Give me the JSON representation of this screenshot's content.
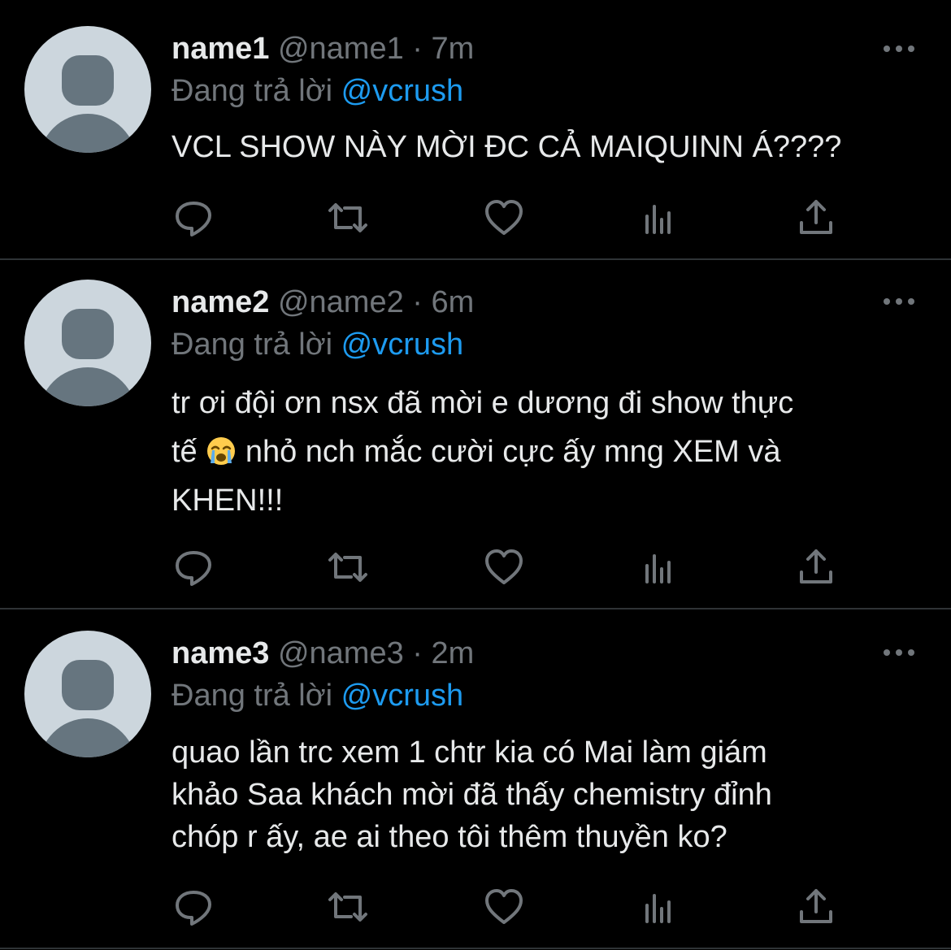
{
  "tweets": [
    {
      "name": "name1",
      "handle": "@name1",
      "separator": "·",
      "time": "7m",
      "reply_prefix": "Đang trả lời",
      "reply_to": "@vcrush",
      "text_before_emoji": "VCL SHOW NÀY MỜI ĐC CẢ MAIQUINN Á????",
      "text_after_emoji": ""
    },
    {
      "name": "name2",
      "handle": "@name2",
      "separator": "·",
      "time": "6m",
      "reply_prefix": "Đang trả lời",
      "reply_to": "@vcrush",
      "text_before_emoji": "tr ơi đội ơn nsx đã mời e dương đi show thực\ntế",
      "emoji": "loudly-crying-face",
      "text_after_emoji": "  nhỏ nch mắc cười cực ấy mng XEM và\nKHEN!!!"
    },
    {
      "name": "name3",
      "handle": "@name3",
      "separator": "·",
      "time": "2m",
      "reply_prefix": "Đang trả lời",
      "reply_to": "@vcrush",
      "text_before_emoji": "quao lần trc xem 1 chtr kia có Mai làm giám\nkhảo Saa khách mời đã thấy chemistry đỉnh\nchóp r ấy, ae ai theo tôi thêm thuyền ko?",
      "text_after_emoji": ""
    }
  ],
  "icons": {
    "reply": "reply-icon",
    "retweet": "retweet-icon",
    "like": "heart-icon",
    "views": "views-icon",
    "share": "share-icon",
    "more": "more-icon"
  },
  "colors": {
    "background": "#000000",
    "text": "#e7e9ea",
    "secondary": "#71767b",
    "accent": "#1d9bf0",
    "divider": "#2f3336",
    "avatar_bg": "#ccd6dd",
    "avatar_fg": "#66757f"
  }
}
